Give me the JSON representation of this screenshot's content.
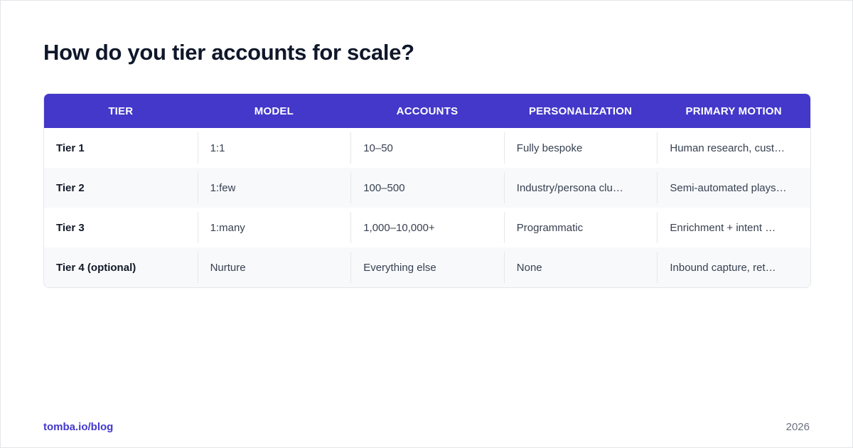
{
  "title": "How do you tier accounts for scale?",
  "table": {
    "headers": [
      "TIER",
      "MODEL",
      "ACCOUNTS",
      "PERSONALIZATION",
      "PRIMARY MOTION"
    ],
    "rows": [
      [
        "Tier 1",
        "1:1",
        "10–50",
        "Fully bespoke",
        "Human research, cust…"
      ],
      [
        "Tier 2",
        "1:few",
        "100–500",
        "Industry/persona clu…",
        "Semi-automated plays…"
      ],
      [
        "Tier 3",
        "1:many",
        "1,000–10,000+",
        "Programmatic",
        "Enrichment + intent …"
      ],
      [
        "Tier 4 (optional)",
        "Nurture",
        "Everything else",
        "None",
        "Inbound capture, ret…"
      ]
    ]
  },
  "footer": {
    "source": "tomba.io/blog",
    "year": "2026"
  },
  "colors": {
    "header_bg": "#4338ca",
    "accent": "#4338ca",
    "title": "#0f172a",
    "alt_row": "#f8f9fb"
  }
}
